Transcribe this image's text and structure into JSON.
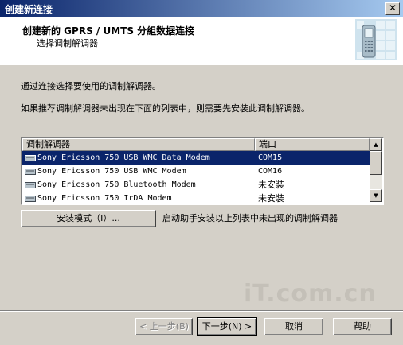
{
  "window": {
    "title": "创建新连接",
    "close_label": "✕"
  },
  "header": {
    "title": "创建新的 GPRS / UMTS 分組数据连接",
    "subtitle": "选择调制解调器"
  },
  "body": {
    "line1": "通过连接选择要使用的调制解调器。",
    "line2": "如果推荐调制解调器未出现在下面的列表中，则需要先安装此调制解调器。"
  },
  "modem_list": {
    "columns": [
      "调制解调器",
      "端口"
    ],
    "rows": [
      {
        "name": "Sony Ericsson 750 USB WMC Data Modem",
        "port": "COM15",
        "selected": true
      },
      {
        "name": "Sony Ericsson 750 USB WMC Modem",
        "port": "COM16",
        "selected": false
      },
      {
        "name": "Sony Ericsson 750 Bluetooth Modem",
        "port": "未安装",
        "selected": false
      },
      {
        "name": "Sony Ericsson 750 IrDA Modem",
        "port": "未安装",
        "selected": false
      }
    ]
  },
  "install": {
    "button_label": "安装模式（I）...",
    "hint": "启动助手安装以上列表中未出现的调制解调器"
  },
  "footer": {
    "back_label": "< 上一步(B)",
    "next_label": "下一步(N) >",
    "cancel_label": "取消",
    "help_label": "帮助"
  },
  "watermark": "iT.com.cn",
  "icons": {
    "modem": "modem-icon",
    "header_image": "phone-grid-icon"
  },
  "colors": {
    "title_bar": "#0a246a",
    "selection": "#0a246a",
    "face": "#d4d0c8"
  }
}
